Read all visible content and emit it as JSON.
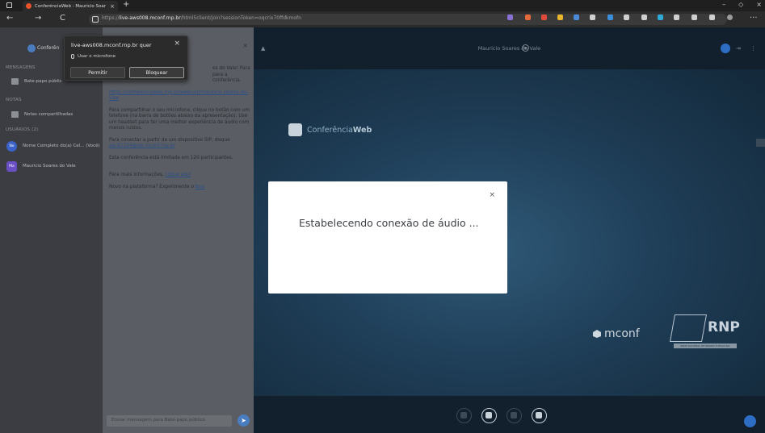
{
  "browser": {
    "tab_title": "ConferênciaWeb - Mauricio Soar",
    "tab_close": "×",
    "new_tab": "+",
    "url_scheme": "https://",
    "url_host": "live-aws008.mconf.rnp.br",
    "url_path": "/html5client/join?sessionToken=oqcrix70ffdkmofn",
    "win_minimize": "–",
    "win_restore": "◇",
    "win_close": "×",
    "back": "←",
    "forward": "→",
    "reload": "C",
    "more": "···"
  },
  "permission": {
    "title": "live-aws008.mconf.rnp.br quer",
    "close": "×",
    "mic_label": "Usar o microfone",
    "allow": "Permitir",
    "block": "Bloquear"
  },
  "sidebar": {
    "brand": "Conferên",
    "messages_section": "MENSAGENS",
    "public_chat": "Bate-papo públic",
    "notes_section": "NOTAS",
    "shared_notes": "Notas compartilhadas",
    "users_section": "USUÁRIOS (2)",
    "users": [
      {
        "initials": "No",
        "name": "Nome Completo do(a) Cel... (Você)",
        "color": "#3b63c9"
      },
      {
        "initials": "Ma",
        "name": "Mauricio Soares do Vale",
        "color": "#6a4fc4"
      }
    ]
  },
  "chat": {
    "close": "×",
    "welcome_1": "es do Vale! Para para a conferência.",
    "link_1": "https://conferenciaweb.rnp.br/webconf/mauricio-soares-do-vale",
    "para_2": "Para compartilhar o seu microfone, clique no botão com um telefone (na barra de botões abaixo da apresentação). Use um headset para ter uma melhor experiência de áudio com menos ruídos.",
    "para_3_prefix": "Para conectar a partir de um dispositivo SIP, disque ",
    "sip_link": "sip:81324@sip.mconf.rnp.br",
    "para_4": "Esta conferência está limitada em 120 participantes.",
    "para_5_prefix": "Para mais informações, ",
    "para_5_link": "clique aqui",
    "para_6_prefix": "Novo na plataforma? Experimente o ",
    "para_6_link": "tour",
    "input_placeholder": "Enviar mensagem para Bate-papo público",
    "send": "➤"
  },
  "main": {
    "title": "Mauricio Soares do Vale",
    "brand_light": "Conferência",
    "brand_bold": "Web",
    "mconf": "mconf",
    "rnp": "RNP",
    "rnp_tagline": "REDE NACIONAL DE ENSINO E PESQUISA"
  },
  "modal": {
    "title": "Estabelecendo conexão de áudio ...",
    "close": "×"
  }
}
